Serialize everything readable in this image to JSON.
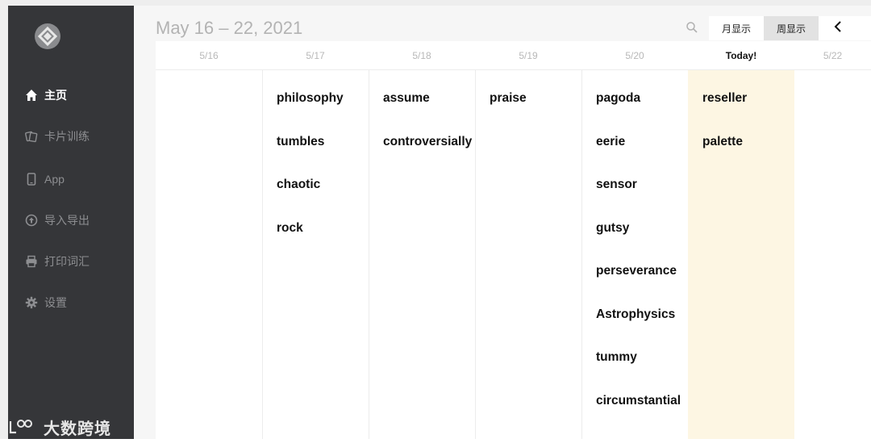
{
  "sidebar": {
    "items": [
      {
        "label": "主页",
        "icon": "home-icon",
        "active": true
      },
      {
        "label": "卡片训练",
        "icon": "cards-icon",
        "active": false
      },
      {
        "label": "App",
        "icon": "phone-icon",
        "active": false
      },
      {
        "label": "导入导出",
        "icon": "import-export-icon",
        "active": false
      },
      {
        "label": "打印词汇",
        "icon": "printer-icon",
        "active": false
      },
      {
        "label": "设置",
        "icon": "gear-icon",
        "active": false
      }
    ],
    "watermark": "大数跨境"
  },
  "header": {
    "date_range": "May 16 – 22, 2021",
    "month_view_label": "月显示",
    "week_view_label": "周显示"
  },
  "calendar": {
    "days": [
      {
        "label": "5/16",
        "today": false,
        "words": []
      },
      {
        "label": "5/17",
        "today": false,
        "words": [
          "philosophy",
          "tumbles",
          "chaotic",
          "rock"
        ]
      },
      {
        "label": "5/18",
        "today": false,
        "words": [
          "assume",
          "controversially"
        ]
      },
      {
        "label": "5/19",
        "today": false,
        "words": [
          "praise"
        ]
      },
      {
        "label": "5/20",
        "today": false,
        "words": [
          "pagoda",
          "eerie",
          "sensor",
          "gutsy",
          "perseverance",
          "Astrophysics",
          "tummy",
          "circumstantial"
        ]
      },
      {
        "label": "Today!",
        "today": true,
        "words": [
          "reseller",
          "palette"
        ]
      },
      {
        "label": "5/22",
        "today": false,
        "words": []
      }
    ]
  },
  "colors": {
    "sidebar_bg": "#353639",
    "today_highlight": "#fdf6e3",
    "active_nav": "#ffffff",
    "inactive_nav": "#8d8e91"
  }
}
